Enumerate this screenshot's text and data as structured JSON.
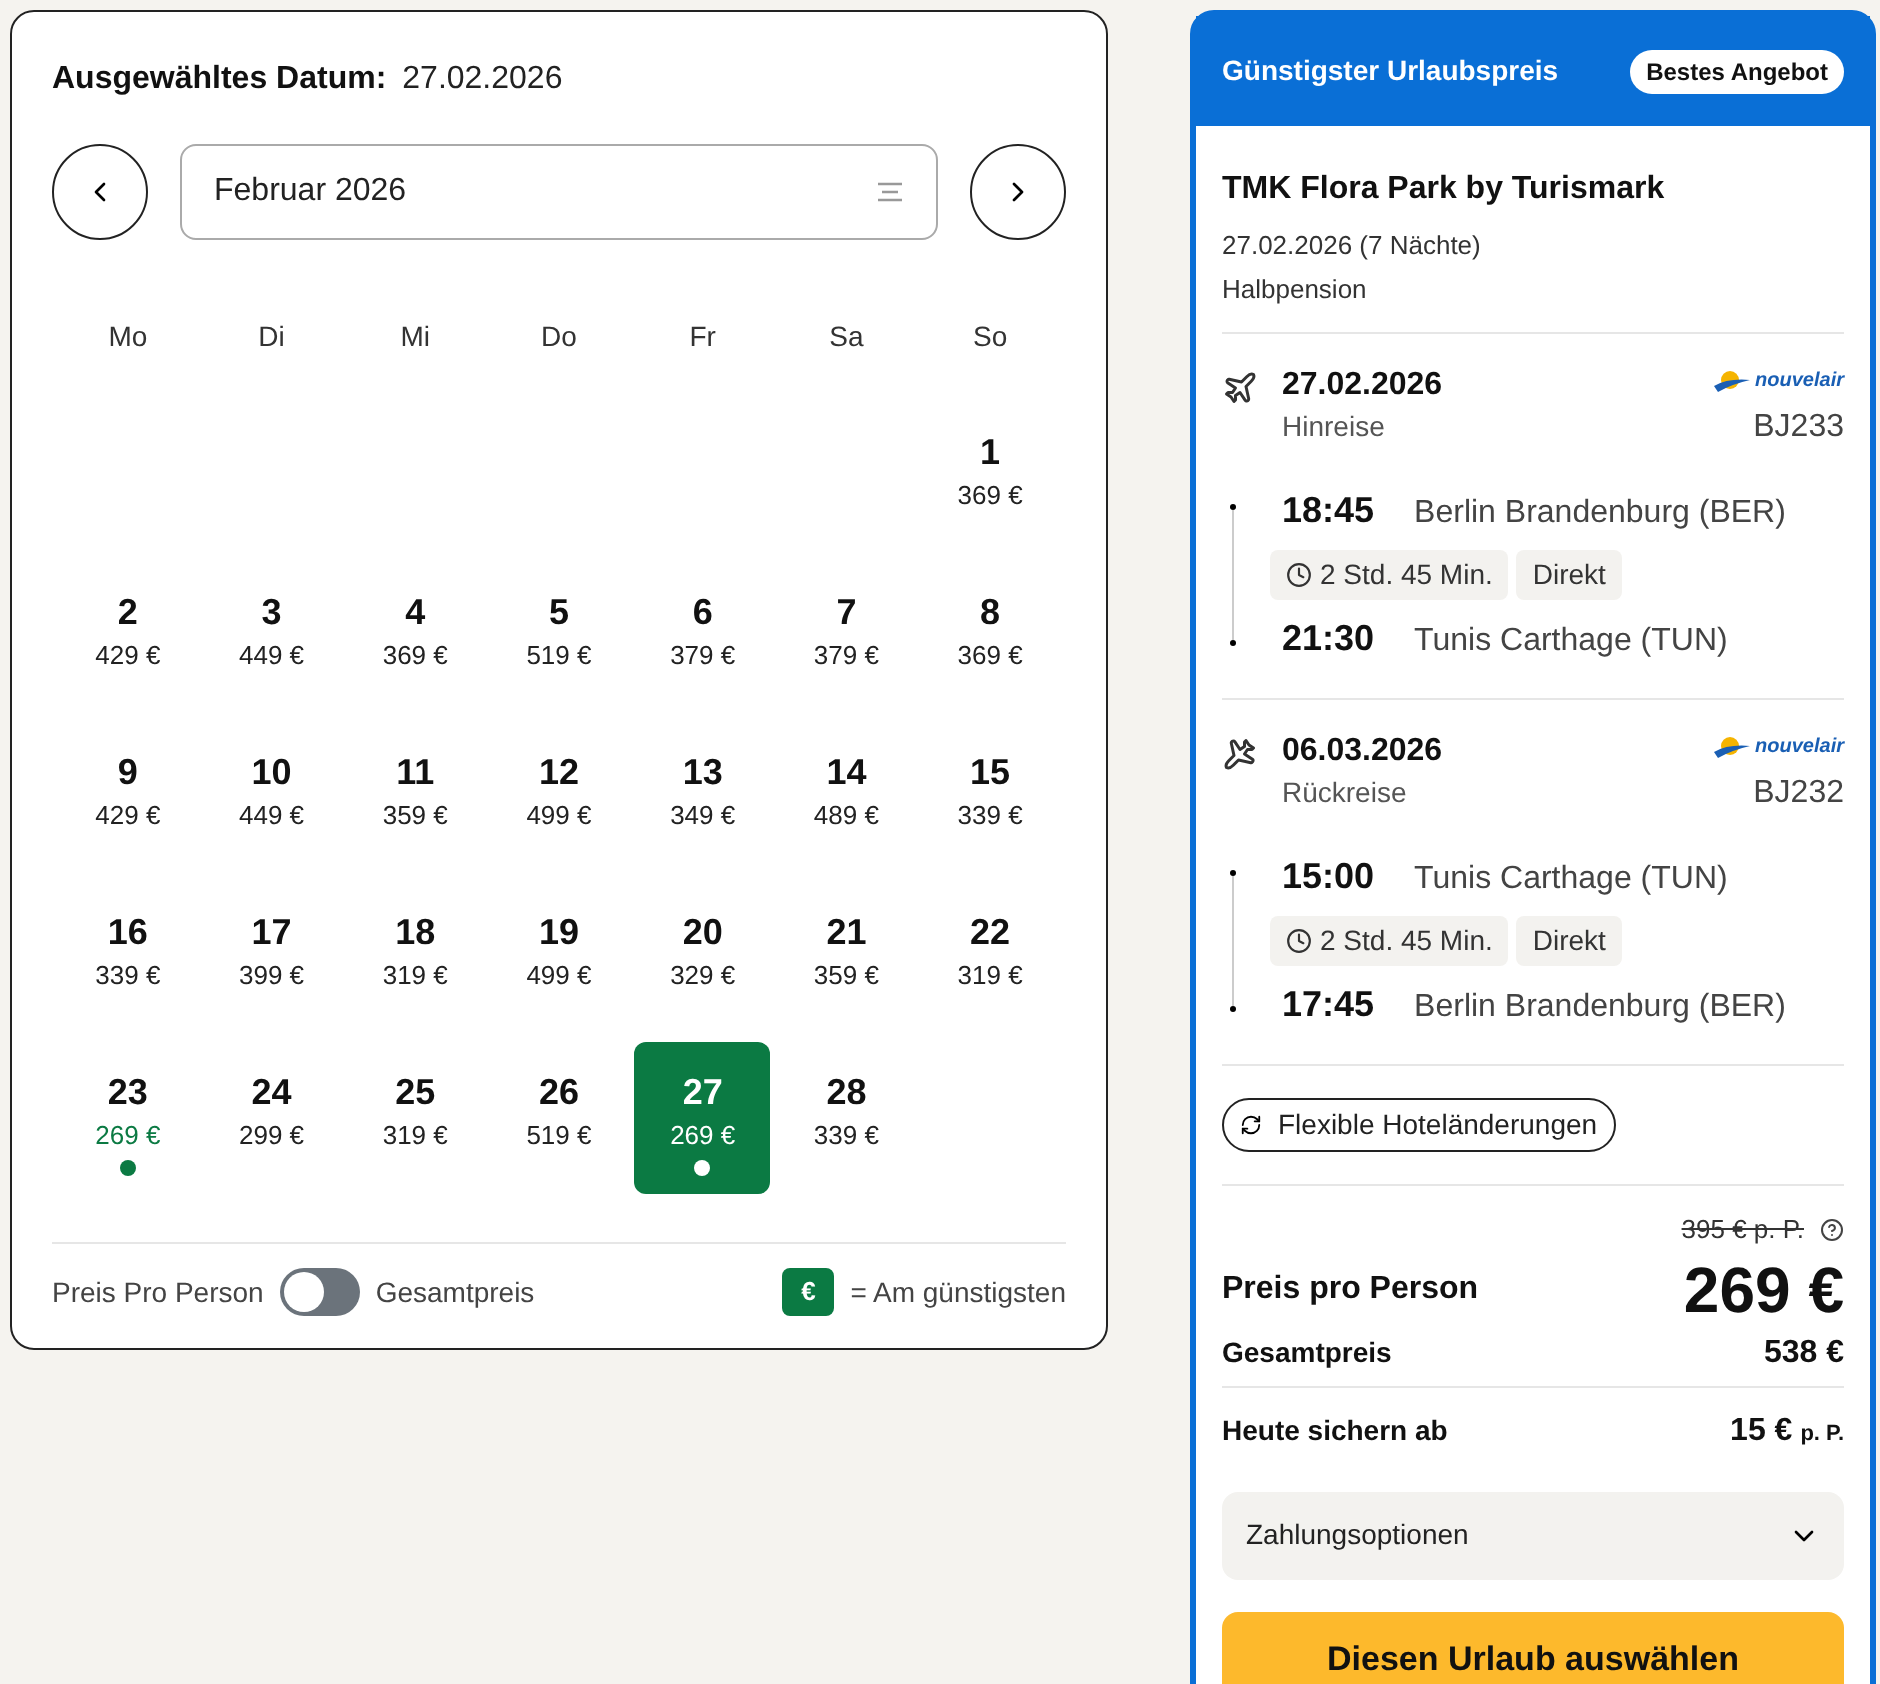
{
  "calendar": {
    "selected_label": "Ausgewähltes Datum:",
    "selected_value": "27.02.2026",
    "month": "Februar 2026",
    "weekdays": [
      "Mo",
      "Di",
      "Mi",
      "Do",
      "Fr",
      "Sa",
      "So"
    ],
    "weeks": [
      [
        {
          "kind": "empty"
        },
        {
          "kind": "empty"
        },
        {
          "kind": "empty"
        },
        {
          "kind": "empty"
        },
        {
          "kind": "empty"
        },
        {
          "kind": "empty"
        },
        {
          "kind": "day",
          "day": "1",
          "price": "369 €",
          "selected": false,
          "cheapest": false
        }
      ],
      [
        {
          "kind": "day",
          "day": "2",
          "price": "429 €",
          "selected": false,
          "cheapest": false
        },
        {
          "kind": "day",
          "day": "3",
          "price": "449 €",
          "selected": false,
          "cheapest": false
        },
        {
          "kind": "day",
          "day": "4",
          "price": "369 €",
          "selected": false,
          "cheapest": false
        },
        {
          "kind": "day",
          "day": "5",
          "price": "519 €",
          "selected": false,
          "cheapest": false
        },
        {
          "kind": "day",
          "day": "6",
          "price": "379 €",
          "selected": false,
          "cheapest": false
        },
        {
          "kind": "day",
          "day": "7",
          "price": "379 €",
          "selected": false,
          "cheapest": false
        },
        {
          "kind": "day",
          "day": "8",
          "price": "369 €",
          "selected": false,
          "cheapest": false
        }
      ],
      [
        {
          "kind": "day",
          "day": "9",
          "price": "429 €",
          "selected": false,
          "cheapest": false
        },
        {
          "kind": "day",
          "day": "10",
          "price": "449 €",
          "selected": false,
          "cheapest": false
        },
        {
          "kind": "day",
          "day": "11",
          "price": "359 €",
          "selected": false,
          "cheapest": false
        },
        {
          "kind": "day",
          "day": "12",
          "price": "499 €",
          "selected": false,
          "cheapest": false
        },
        {
          "kind": "day",
          "day": "13",
          "price": "349 €",
          "selected": false,
          "cheapest": false
        },
        {
          "kind": "day",
          "day": "14",
          "price": "489 €",
          "selected": false,
          "cheapest": false
        },
        {
          "kind": "day",
          "day": "15",
          "price": "339 €",
          "selected": false,
          "cheapest": false
        }
      ],
      [
        {
          "kind": "day",
          "day": "16",
          "price": "339 €",
          "selected": false,
          "cheapest": false
        },
        {
          "kind": "day",
          "day": "17",
          "price": "399 €",
          "selected": false,
          "cheapest": false
        },
        {
          "kind": "day",
          "day": "18",
          "price": "319 €",
          "selected": false,
          "cheapest": false
        },
        {
          "kind": "day",
          "day": "19",
          "price": "499 €",
          "selected": false,
          "cheapest": false
        },
        {
          "kind": "day",
          "day": "20",
          "price": "329 €",
          "selected": false,
          "cheapest": false
        },
        {
          "kind": "day",
          "day": "21",
          "price": "359 €",
          "selected": false,
          "cheapest": false
        },
        {
          "kind": "day",
          "day": "22",
          "price": "319 €",
          "selected": false,
          "cheapest": false
        }
      ],
      [
        {
          "kind": "day",
          "day": "23",
          "price": "269 €",
          "selected": false,
          "cheapest": true
        },
        {
          "kind": "day",
          "day": "24",
          "price": "299 €",
          "selected": false,
          "cheapest": false
        },
        {
          "kind": "day",
          "day": "25",
          "price": "319 €",
          "selected": false,
          "cheapest": false
        },
        {
          "kind": "day",
          "day": "26",
          "price": "519 €",
          "selected": false,
          "cheapest": false
        },
        {
          "kind": "day",
          "day": "27",
          "price": "269 €",
          "selected": true,
          "cheapest": true
        },
        {
          "kind": "day",
          "day": "28",
          "price": "339 €",
          "selected": false,
          "cheapest": false
        },
        {
          "kind": "empty"
        }
      ]
    ],
    "toggle": {
      "left_label": "Preis Pro Person",
      "right_label": "Gesamtpreis",
      "on": false
    },
    "legend": {
      "badge": "€",
      "text": "= Am günstigsten"
    }
  },
  "offer": {
    "header": "Günstigster Urlaubspreis",
    "badge": "Bestes Angebot",
    "hotel": "TMK Flora Park by Turismark",
    "dates": "27.02.2026 (7 Nächte)",
    "board": "Halbpension",
    "flights": [
      {
        "kind": "outbound",
        "date": "27.02.2026",
        "label": "Hinreise",
        "airline": "nouvelair",
        "flight_no": "BJ233",
        "dep_time": "18:45",
        "dep_airport": "Berlin Brandenburg (BER)",
        "duration": "2 Std. 45 Min.",
        "stops": "Direkt",
        "arr_time": "21:30",
        "arr_airport": "Tunis Carthage (TUN)"
      },
      {
        "kind": "return",
        "date": "06.03.2026",
        "label": "Rückreise",
        "airline": "nouvelair",
        "flight_no": "BJ232",
        "dep_time": "15:00",
        "dep_airport": "Tunis Carthage (TUN)",
        "duration": "2 Std. 45 Min.",
        "stops": "Direkt",
        "arr_time": "17:45",
        "arr_airport": "Berlin Brandenburg (BER)"
      }
    ],
    "feature": "Flexible Hoteländerungen",
    "old_price": "395 € p. P.",
    "price_label": "Preis pro Person",
    "price": "269 €",
    "total_label": "Gesamtpreis",
    "total": "538 €",
    "deposit_label": "Heute sichern ab",
    "deposit": "15 €",
    "deposit_unit": "p. P.",
    "payment": "Zahlungsoptionen",
    "cta": "Diesen Urlaub auswählen"
  }
}
